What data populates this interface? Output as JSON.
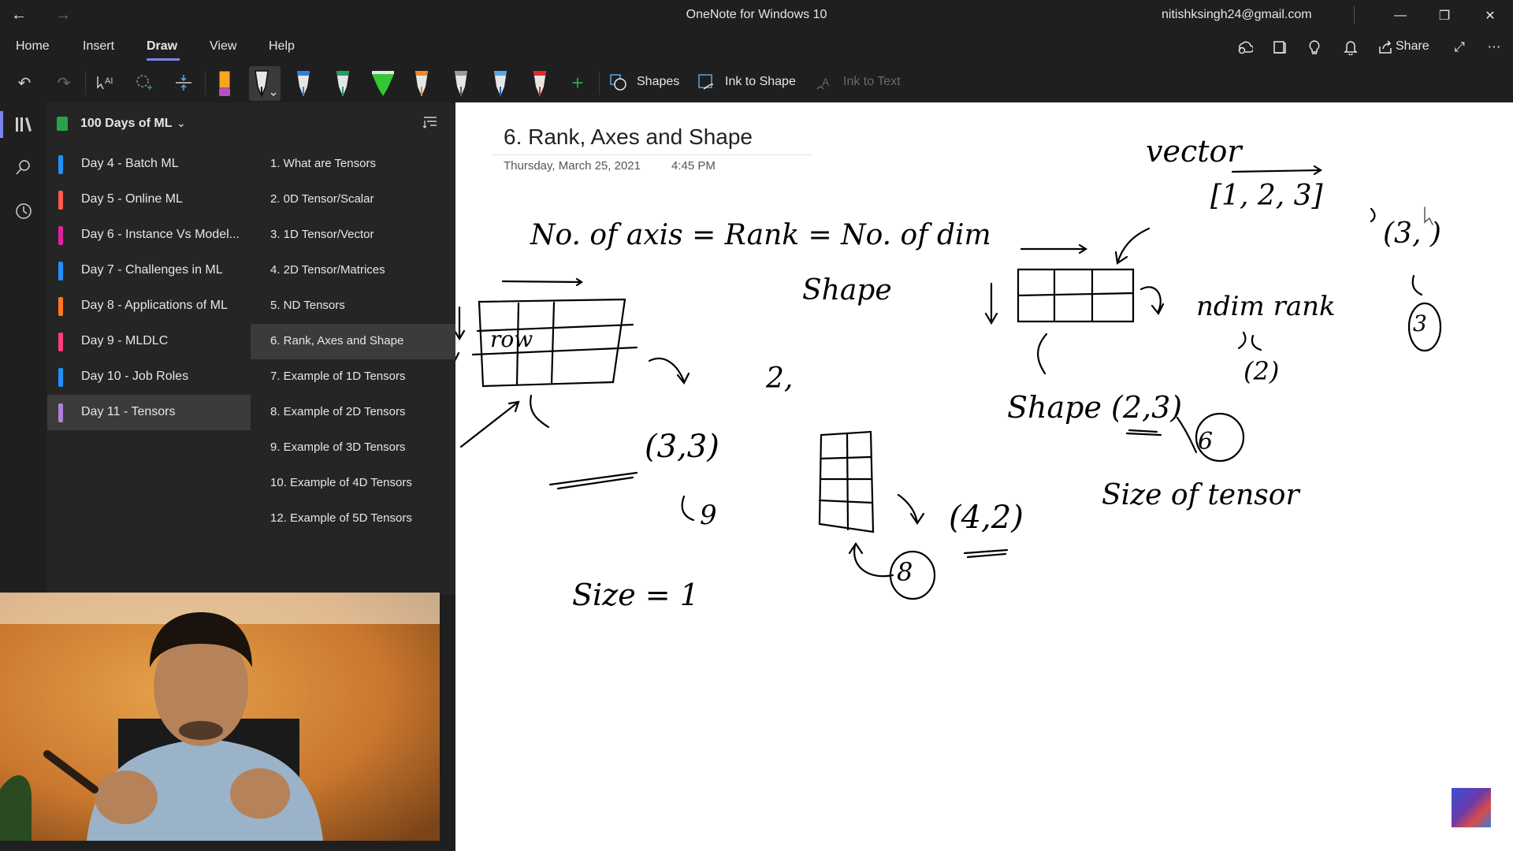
{
  "window": {
    "title": "OneNote for Windows 10",
    "account": "nitishksingh24@gmail.com"
  },
  "menu": {
    "items": [
      "Home",
      "Insert",
      "Draw",
      "View",
      "Help"
    ],
    "active": "Draw",
    "share_label": "Share"
  },
  "toolbar": {
    "shapes_label": "Shapes",
    "ink_to_shape_label": "Ink to Shape",
    "ink_to_text_label": "Ink to Text",
    "pens": [
      {
        "name": "highlighter-pen",
        "color": "#b84fc2"
      },
      {
        "name": "black-pen",
        "color": "#111111"
      },
      {
        "name": "blue-pen",
        "color": "#2f7fe0"
      },
      {
        "name": "green-pen",
        "color": "#21a060"
      },
      {
        "name": "green-highlighter",
        "color": "#36c736"
      },
      {
        "name": "orange-pen",
        "color": "#f08a24"
      },
      {
        "name": "gray-pen",
        "color": "#9a9a9a"
      },
      {
        "name": "light-blue-pen",
        "color": "#57a7e8"
      },
      {
        "name": "red-pen",
        "color": "#e02b2b"
      }
    ]
  },
  "notebook": {
    "name": "100 Days of ML"
  },
  "sections": [
    {
      "label": "Day 4 - Batch ML",
      "color": "#1e90ff"
    },
    {
      "label": "Day 5 - Online ML",
      "color": "#ff5a4f"
    },
    {
      "label": "Day 6 - Instance Vs Model...",
      "color": "#e0219b"
    },
    {
      "label": "Day 7 - Challenges in ML",
      "color": "#1e90ff"
    },
    {
      "label": "Day 8 - Applications of ML",
      "color": "#ff7a1a"
    },
    {
      "label": "Day 9 - MLDLC",
      "color": "#ff3d7f"
    },
    {
      "label": "Day 10 - Job Roles",
      "color": "#1e90ff"
    },
    {
      "label": "Day 11 - Tensors",
      "color": "#b07fd8"
    }
  ],
  "selected_section": "Day 11 - Tensors",
  "pages": [
    "1. What are Tensors",
    "2. 0D Tensor/Scalar",
    "3. 1D Tensor/Vector",
    "4. 2D Tensor/Matrices",
    "5. ND Tensors",
    "6. Rank, Axes and Shape",
    "7. Example of 1D Tensors",
    "8. Example of 2D Tensors",
    "9. Example of 3D Tensors",
    "10. Example of 4D Tensors",
    "12. Example of 5D Tensors"
  ],
  "selected_page": "6. Rank, Axes and Shape",
  "note": {
    "title": "6. Rank, Axes and Shape",
    "date": "Thursday, March 25, 2021",
    "time": "4:45 PM"
  },
  "handwriting": {
    "axis_rank_ndim": "No. of axis = Rank = No. of dim",
    "vector": "vector",
    "vector_value": "[1, 2, 3]",
    "vector_shape": "(3, )",
    "vector_rank": "3",
    "shape_word": "Shape",
    "row": "row",
    "shape_33": "(3,3)",
    "two_comma": "2,",
    "size_9": "9",
    "size_1": "Size = 1",
    "shape_42": "(4,2)",
    "size_8": "8",
    "ndim_rank": "ndim rank",
    "ndim_value": "(2)",
    "shape_23": "Shape (2,3)",
    "size_6": "6",
    "size_of_tensor": "Size of tensor"
  }
}
